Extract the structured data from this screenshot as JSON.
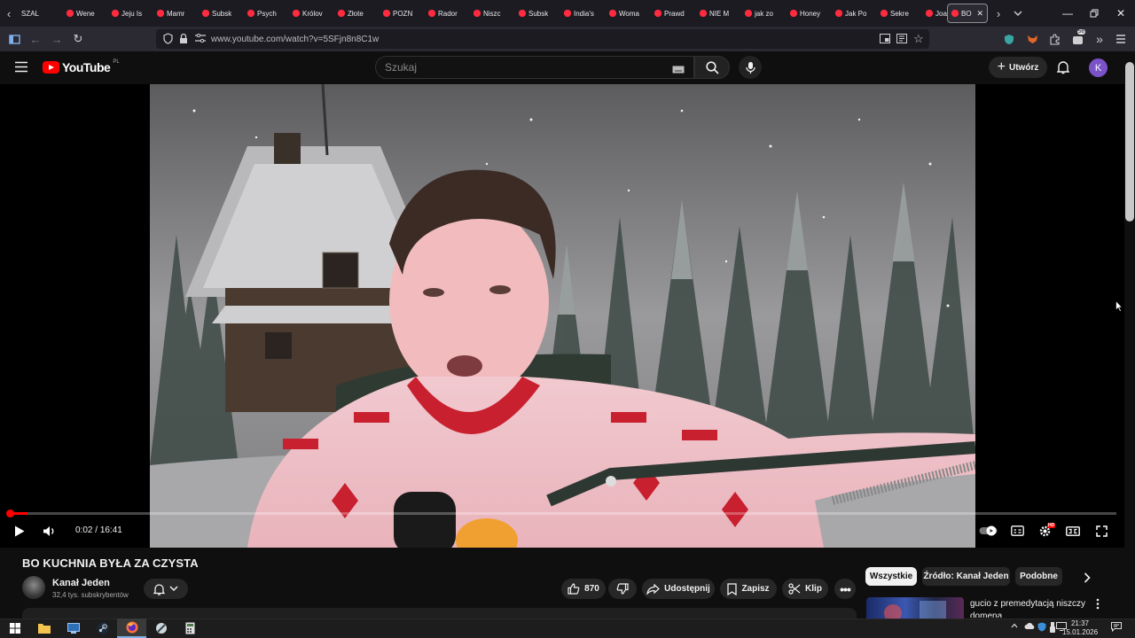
{
  "browser": {
    "tabs": [
      {
        "label": "SZAL"
      },
      {
        "label": "Wene"
      },
      {
        "label": "Jeju Is"
      },
      {
        "label": "Mamr"
      },
      {
        "label": "Subsk"
      },
      {
        "label": "Psych"
      },
      {
        "label": "Królov"
      },
      {
        "label": "Złote"
      },
      {
        "label": "POZN"
      },
      {
        "label": "Rador"
      },
      {
        "label": "Niszc"
      },
      {
        "label": "Subsk"
      },
      {
        "label": "India's"
      },
      {
        "label": "Woma"
      },
      {
        "label": "Prawd"
      },
      {
        "label": "NIE M"
      },
      {
        "label": "jak zo"
      },
      {
        "label": "Honey"
      },
      {
        "label": "Jak Po"
      },
      {
        "label": "Sekre"
      },
      {
        "label": "Joann"
      }
    ],
    "active_tab": {
      "label": "BO",
      "close": "✕"
    },
    "url": "www.youtube.com/watch?v=5SFjn8n8C1w",
    "extension_badge": "56",
    "accent": "#ff2b3f"
  },
  "youtube": {
    "logo_text": "YouTube",
    "region": "PL",
    "search_placeholder": "Szukaj",
    "create_label": "Utwórz",
    "avatar_letter": "K",
    "brand_color": "#ff0000"
  },
  "player": {
    "current_time": "0:02",
    "duration": "16:41",
    "time_separator": " / ",
    "progress_fraction": 0.002,
    "settings_badge": "HD"
  },
  "video": {
    "title": "BO KUCHNIA BYŁA ZA CZYSTA",
    "channel": "Kanał Jeden",
    "subscribers": "32,4 tys. subskrybentów",
    "likes": "870",
    "share_label": "Udostępnij",
    "save_label": "Zapisz",
    "clip_label": "Klip"
  },
  "recommendations": {
    "chips": [
      {
        "label": "Wszystkie",
        "selected": true
      },
      {
        "label": "Źródło: Kanał Jeden",
        "selected": false
      },
      {
        "label": "Podobne",
        "selected": false
      }
    ],
    "first_title": "gucio z premedytacją niszczy domena"
  },
  "taskbar": {
    "time": "21:37",
    "date": "15.01.2026"
  }
}
